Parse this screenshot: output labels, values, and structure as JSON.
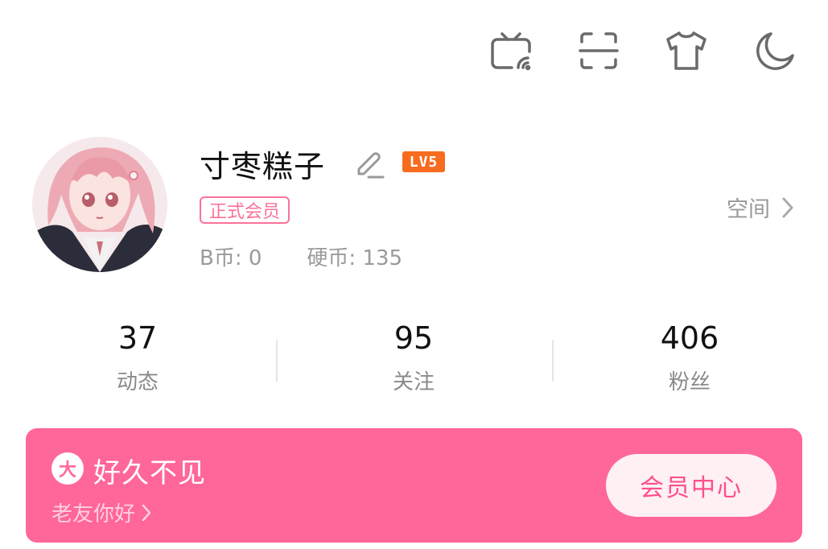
{
  "header": {
    "icons": [
      "tv-cast-icon",
      "scan-icon",
      "tshirt-icon",
      "moon-icon"
    ]
  },
  "profile": {
    "username": "寸枣糕子",
    "level": "LV5",
    "member_tag": "正式会员",
    "b_coin_label": "B币: 0",
    "hard_coin_label": "硬币: 135",
    "space_label": "空间"
  },
  "stats": [
    {
      "value": "37",
      "label": "动态"
    },
    {
      "value": "95",
      "label": "关注"
    },
    {
      "value": "406",
      "label": "粉丝"
    }
  ],
  "vip_banner": {
    "badge": "大",
    "title": "好久不见",
    "subtitle": "老友你好",
    "button": "会员中心"
  },
  "colors": {
    "pink": "#fb7299",
    "vip_bg": "#ff6699",
    "level_orange": "#f76c1f"
  }
}
